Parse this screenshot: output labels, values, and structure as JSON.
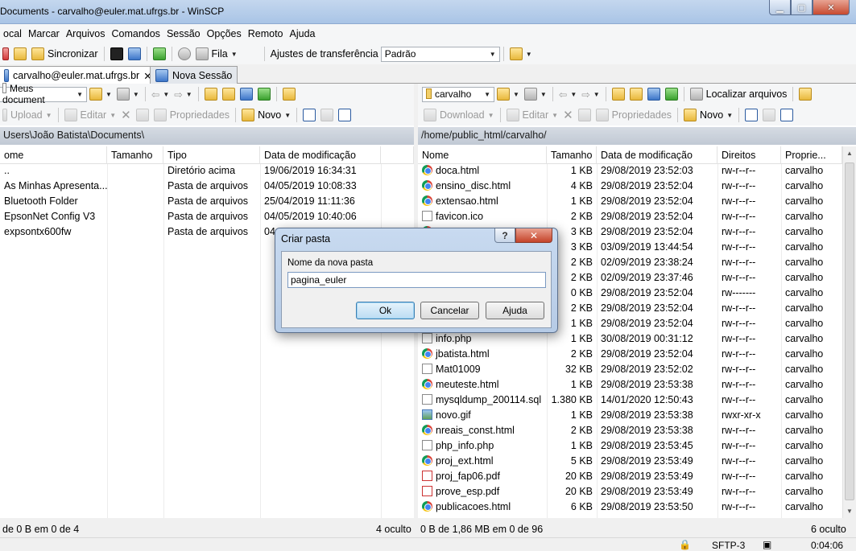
{
  "window": {
    "title": "Documents - carvalho@euler.mat.ufrgs.br - WinSCP"
  },
  "menu": [
    "ocal",
    "Marcar",
    "Arquivos",
    "Comandos",
    "Sessão",
    "Opções",
    "Remoto",
    "Ajuda"
  ],
  "toolbar": {
    "sync_label": "Sincronizar",
    "queue_label": "Fila",
    "transfer_label": "Ajustes de transferência",
    "transfer_value": "Padrão"
  },
  "tabs": [
    {
      "label": "carvalho@euler.mat.ufrgs.br",
      "active": true
    },
    {
      "label": "Nova Sessão",
      "active": false
    }
  ],
  "local": {
    "location": "Meus document",
    "upload_label": "Upload",
    "edit_label": "Editar",
    "properties_label": "Propriedades",
    "new_label": "Novo",
    "path": "Users\\João Batista\\Documents\\",
    "columns": [
      "ome",
      "Tamanho",
      "Tipo",
      "Data de modificação"
    ],
    "files": [
      {
        "name": "..",
        "size": "",
        "type": "Diretório acima",
        "date": "19/06/2019  16:34:31"
      },
      {
        "name": "As Minhas Apresenta...",
        "size": "",
        "type": "Pasta de arquivos",
        "date": "04/05/2019  10:08:33"
      },
      {
        "name": "Bluetooth Folder",
        "size": "",
        "type": "Pasta de arquivos",
        "date": "25/04/2019  11:11:36"
      },
      {
        "name": "EpsonNet Config V3",
        "size": "",
        "type": "Pasta de arquivos",
        "date": "04/05/2019  10:40:06"
      },
      {
        "name": "expsontx600fw",
        "size": "",
        "type": "Pasta de arquivos",
        "date": "04"
      }
    ],
    "status_left": "de 0 B em 0 de 4",
    "status_right": "4 oculto"
  },
  "remote": {
    "location": "carvalho",
    "find_label": "Localizar arquivos",
    "download_label": "Download",
    "edit_label": "Editar",
    "properties_label": "Propriedades",
    "new_label": "Novo",
    "path": "/home/public_html/carvalho/",
    "columns": [
      "Nome",
      "Tamanho",
      "Data de modificação",
      "Direitos",
      "Proprie..."
    ],
    "files": [
      {
        "name": "doca.html",
        "icon": "chrome",
        "size": "1 KB",
        "date": "29/08/2019 23:52:03",
        "rights": "rw-r--r--",
        "owner": "carvalho"
      },
      {
        "name": "ensino_disc.html",
        "icon": "chrome",
        "size": "4 KB",
        "date": "29/08/2019 23:52:04",
        "rights": "rw-r--r--",
        "owner": "carvalho"
      },
      {
        "name": "extensao.html",
        "icon": "chrome",
        "size": "1 KB",
        "date": "29/08/2019 23:52:04",
        "rights": "rw-r--r--",
        "owner": "carvalho"
      },
      {
        "name": "favicon.ico",
        "icon": "doc",
        "size": "2 KB",
        "date": "29/08/2019 23:52:04",
        "rights": "rw-r--r--",
        "owner": "carvalho"
      },
      {
        "name": "",
        "icon": "chrome",
        "size": "3 KB",
        "date": "29/08/2019 23:52:04",
        "rights": "rw-r--r--",
        "owner": "carvalho"
      },
      {
        "name": "",
        "icon": "",
        "size": "3 KB",
        "date": "03/09/2019 13:44:54",
        "rights": "rw-r--r--",
        "owner": "carvalho"
      },
      {
        "name": "",
        "icon": "",
        "size": "2 KB",
        "date": "02/09/2019 23:38:24",
        "rights": "rw-r--r--",
        "owner": "carvalho"
      },
      {
        "name": "",
        "icon": "",
        "size": "2 KB",
        "date": "02/09/2019 23:37:46",
        "rights": "rw-r--r--",
        "owner": "carvalho"
      },
      {
        "name": "",
        "icon": "",
        "size": "0 KB",
        "date": "29/08/2019 23:52:04",
        "rights": "rw-------",
        "owner": "carvalho"
      },
      {
        "name": "",
        "icon": "",
        "size": "2 KB",
        "date": "29/08/2019 23:52:04",
        "rights": "rw-r--r--",
        "owner": "carvalho"
      },
      {
        "name": "",
        "icon": "",
        "size": "1 KB",
        "date": "29/08/2019 23:52:04",
        "rights": "rw-r--r--",
        "owner": "carvalho"
      },
      {
        "name": "info.php",
        "icon": "doc",
        "size": "1 KB",
        "date": "30/08/2019 00:31:12",
        "rights": "rw-r--r--",
        "owner": "carvalho"
      },
      {
        "name": "jbatista.html",
        "icon": "chrome",
        "size": "2 KB",
        "date": "29/08/2019 23:52:04",
        "rights": "rw-r--r--",
        "owner": "carvalho"
      },
      {
        "name": "Mat01009",
        "icon": "doc",
        "size": "32 KB",
        "date": "29/08/2019 23:52:02",
        "rights": "rw-r--r--",
        "owner": "carvalho"
      },
      {
        "name": "meuteste.html",
        "icon": "chrome",
        "size": "1 KB",
        "date": "29/08/2019 23:53:38",
        "rights": "rw-r--r--",
        "owner": "carvalho"
      },
      {
        "name": "mysqldump_200114.sql",
        "icon": "doc",
        "size": "1.380 KB",
        "date": "14/01/2020 12:50:43",
        "rights": "rw-r--r--",
        "owner": "carvalho"
      },
      {
        "name": "novo.gif",
        "icon": "img",
        "size": "1 KB",
        "date": "29/08/2019 23:53:38",
        "rights": "rwxr-xr-x",
        "owner": "carvalho"
      },
      {
        "name": "nreais_const.html",
        "icon": "chrome",
        "size": "2 KB",
        "date": "29/08/2019 23:53:38",
        "rights": "rw-r--r--",
        "owner": "carvalho"
      },
      {
        "name": "php_info.php",
        "icon": "doc",
        "size": "1 KB",
        "date": "29/08/2019 23:53:45",
        "rights": "rw-r--r--",
        "owner": "carvalho"
      },
      {
        "name": "proj_ext.html",
        "icon": "chrome",
        "size": "5 KB",
        "date": "29/08/2019 23:53:49",
        "rights": "rw-r--r--",
        "owner": "carvalho"
      },
      {
        "name": "proj_fap06.pdf",
        "icon": "pdf",
        "size": "20 KB",
        "date": "29/08/2019 23:53:49",
        "rights": "rw-r--r--",
        "owner": "carvalho"
      },
      {
        "name": "prove_esp.pdf",
        "icon": "pdf",
        "size": "20 KB",
        "date": "29/08/2019 23:53:49",
        "rights": "rw-r--r--",
        "owner": "carvalho"
      },
      {
        "name": "publicacoes.html",
        "icon": "chrome",
        "size": "6 KB",
        "date": "29/08/2019 23:53:50",
        "rights": "rw-r--r--",
        "owner": "carvalho"
      }
    ],
    "status_left": "0 B de 1,86 MB em 0 de 96",
    "status_right": "6 oculto"
  },
  "bottom": {
    "protocol": "SFTP-3",
    "time": "0:04:06"
  },
  "dialog": {
    "title": "Criar pasta",
    "help_glyph": "?",
    "close_glyph": "✕",
    "label": "Nome da nova pasta",
    "value": "pagina_euler",
    "ok_label": "Ok",
    "cancel_label": "Cancelar",
    "help_label": "Ajuda"
  }
}
